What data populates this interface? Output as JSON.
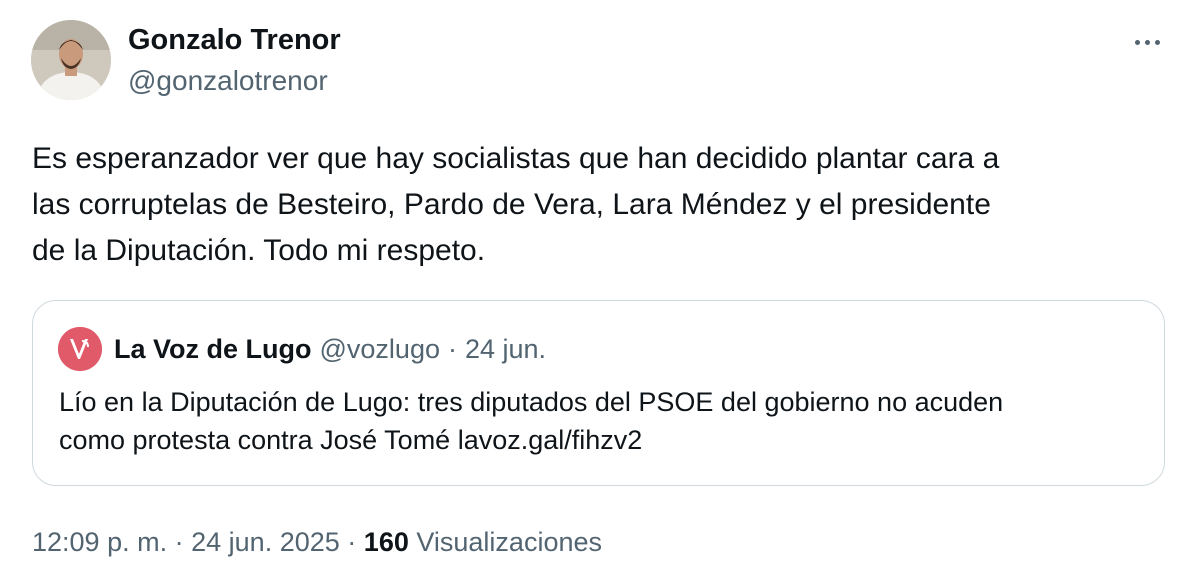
{
  "author": {
    "name": "Gonzalo Trenor",
    "handle": "@gonzalotrenor",
    "avatar_icon": "profile-photo-avatar"
  },
  "more_icon": "more-horizontal-icon",
  "tweet": {
    "text_lines": [
      "Es esperanzador ver que hay socialistas que han decidido plantar cara a",
      "las corruptelas de Besteiro, Pardo de Vera, Lara Méndez y el presidente",
      "de la Diputación. Todo mi respeto."
    ]
  },
  "quoted_tweet": {
    "author_name": "La Voz de Lugo",
    "author_handle": "@vozlugo",
    "separator": "·",
    "date": "24 jun.",
    "logo_icon": "la-voz-de-lugo-logo",
    "logo_color": "#e05a6a",
    "text_lines": [
      "Lío en la Diputación de Lugo: tres diputados del PSOE del gobierno no acuden",
      "como protesta contra José Tomé lavoz.gal/fihzv2"
    ]
  },
  "footer": {
    "time": "12:09 p. m.",
    "separator": "·",
    "date": "24 jun. 2025",
    "views_count": "160",
    "views_label": "Visualizaciones"
  },
  "colors": {
    "text_primary": "#0f1419",
    "text_secondary": "#536471",
    "border": "#cfd9de"
  }
}
